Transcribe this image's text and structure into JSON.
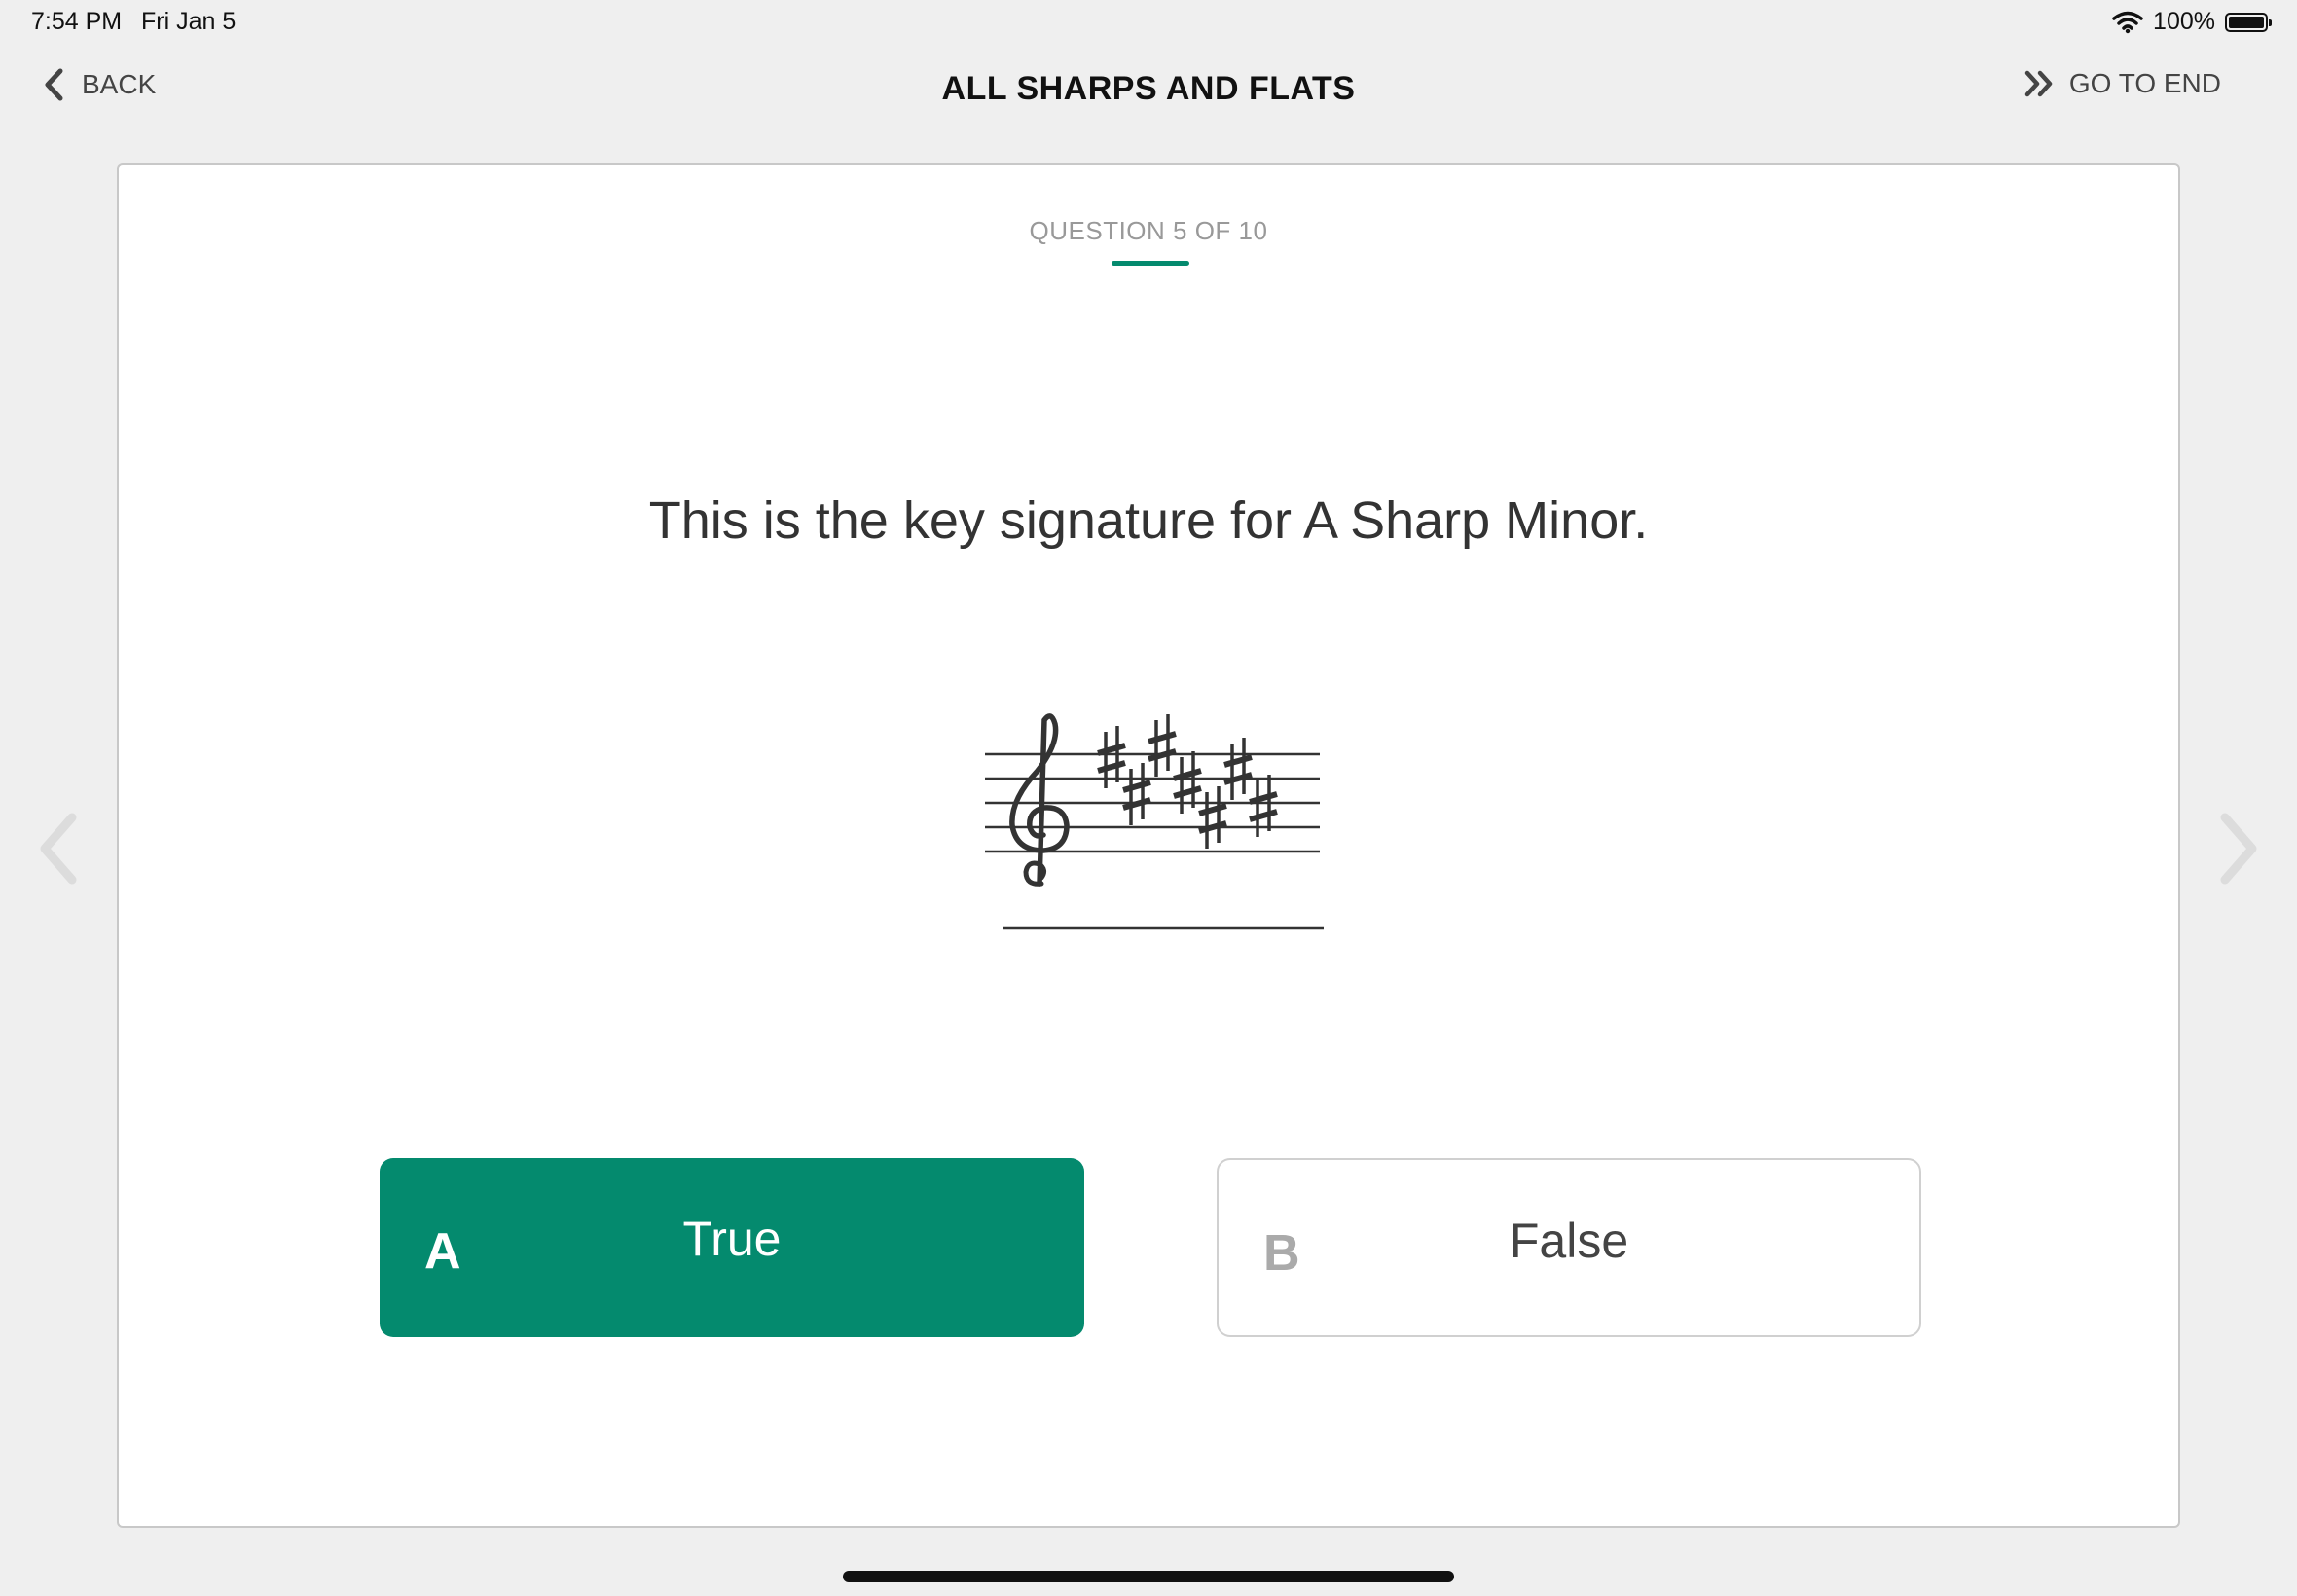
{
  "status_bar": {
    "time": "7:54 PM",
    "date": "Fri Jan 5",
    "battery": "100%",
    "wifi_icon": "wifi-icon",
    "battery_icon": "battery-icon"
  },
  "nav": {
    "back_label": "BACK",
    "back_icon": "chevron-left-icon",
    "title": "ALL SHARPS AND FLATS",
    "go_to_end_label": "GO TO END",
    "go_to_end_icon": "double-chevron-right-icon"
  },
  "question": {
    "counter": "QUESTION 5 OF 10",
    "text": "This is the key signature for A Sharp Minor.",
    "image_icon": "treble-clef-key-signature-seven-sharps"
  },
  "answers": [
    {
      "letter": "A",
      "label": "True",
      "selected": true
    },
    {
      "letter": "B",
      "label": "False",
      "selected": false
    }
  ],
  "colors": {
    "accent": "#048a6e",
    "background": "#efefef",
    "card": "#ffffff"
  }
}
